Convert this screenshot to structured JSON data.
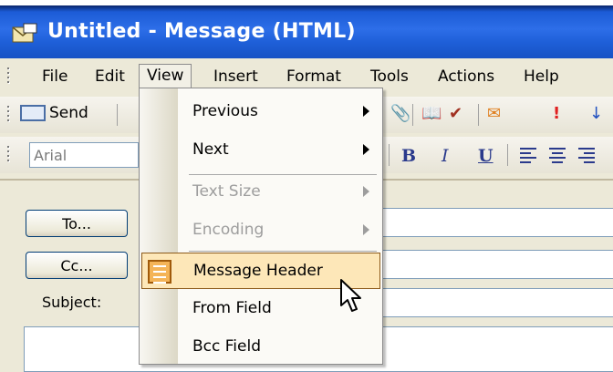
{
  "window": {
    "title": "Untitled - Message (HTML)"
  },
  "menubar": {
    "items": [
      "File",
      "Edit",
      "View",
      "Insert",
      "Format",
      "Tools",
      "Actions",
      "Help"
    ]
  },
  "toolbar": {
    "send_label": "Send",
    "font_name": "Arial",
    "bold": "B",
    "italic": "I",
    "underline": "U"
  },
  "form": {
    "to_label": "To...",
    "cc_label": "Cc...",
    "subject_label": "Subject:"
  },
  "view_menu": {
    "items": [
      {
        "label": "Previous",
        "submenu": true,
        "disabled": false
      },
      {
        "label": "Next",
        "submenu": true,
        "disabled": false
      },
      {
        "label": "Text Size",
        "submenu": true,
        "disabled": true
      },
      {
        "label": "Encoding",
        "submenu": true,
        "disabled": true
      },
      {
        "label": "Message Header",
        "submenu": false,
        "disabled": false,
        "highlighted": true
      },
      {
        "label": "From Field",
        "submenu": false,
        "disabled": false
      },
      {
        "label": "Bcc Field",
        "submenu": false,
        "disabled": false
      }
    ]
  },
  "colors": {
    "titlebar": "#2d6ee8",
    "highlight": "#fde7b8",
    "menu_bg": "#ece9d8"
  },
  "icons": [
    "message-icon",
    "send-icon",
    "attach-icon",
    "address-book-icon",
    "check-names-icon",
    "flag-icon",
    "importance-icon",
    "arrow-down-icon",
    "message-header-icon",
    "mouse-cursor-icon"
  ]
}
